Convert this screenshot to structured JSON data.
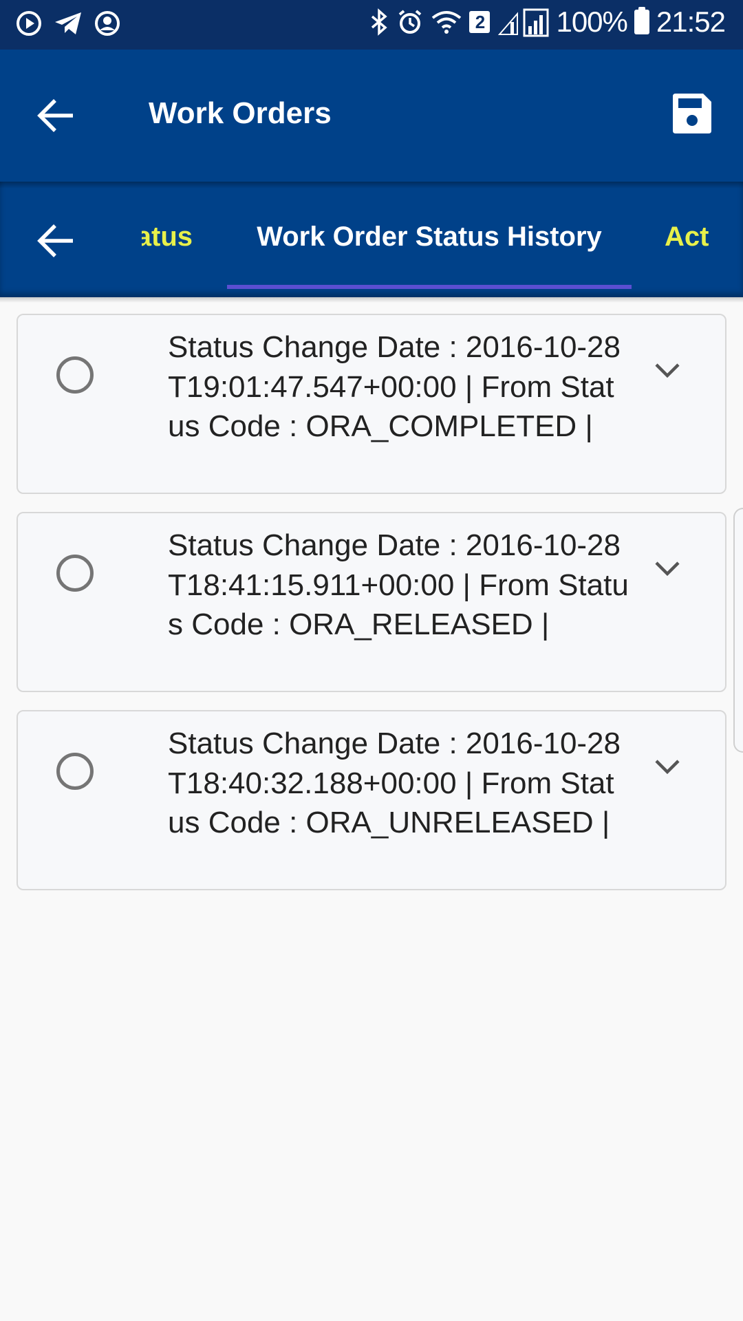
{
  "status_bar": {
    "battery_text": "100%",
    "time": "21:52",
    "notification_badge": "2",
    "left_icons": [
      "media-play-icon",
      "telegram-icon",
      "account-circle-icon"
    ],
    "right_icons": [
      "bluetooth-icon",
      "alarm-icon",
      "wifi-icon",
      "signal-icon",
      "battery-icon"
    ]
  },
  "app_bar": {
    "title": "Work Orders",
    "back_icon": "arrow-left-icon",
    "save_icon": "save-icon"
  },
  "tabs": {
    "prev_label": "Status",
    "active_label": "Work Order Status History",
    "next_label": "Act",
    "back_icon": "arrow-left-icon"
  },
  "items": [
    {
      "text": "Status Change Date : 2016-10-28T19:01:47.547+00:00 | From Status Code : ORA_COMPLETED |"
    },
    {
      "text": "Status Change Date : 2016-10-28T18:41:15.911+00:00 | From Status Code : ORA_RELEASED |"
    },
    {
      "text": "Status Change Date : 2016-10-28T18:40:32.188+00:00 | From Status Code : ORA_UNRELEASED |"
    }
  ],
  "colors": {
    "status_bar": "#0b2f66",
    "app_bar": "#004189",
    "tab_accent": "#e8f04a",
    "tab_indicator": "#5b4fd1",
    "background": "#f9f9f9"
  }
}
